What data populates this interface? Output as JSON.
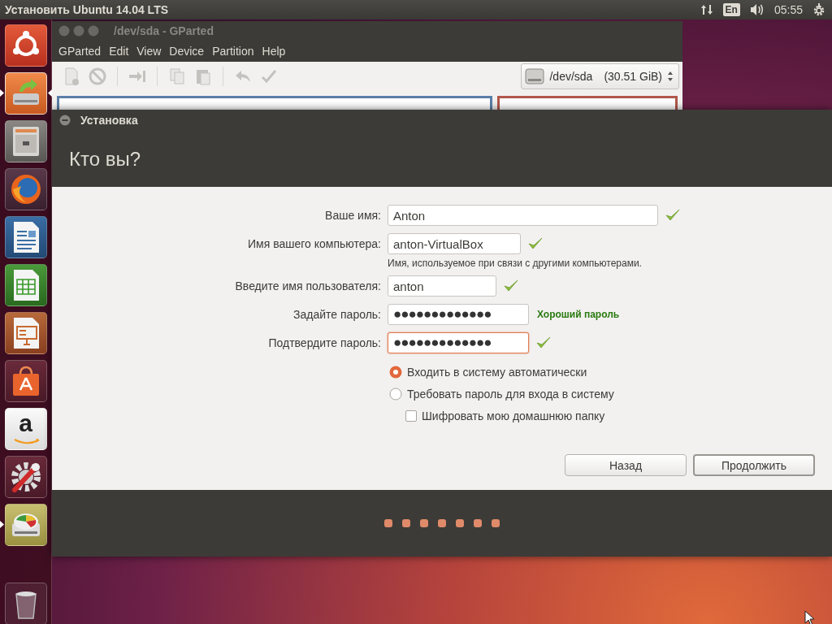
{
  "top_panel": {
    "title": "Установить Ubuntu 14.04 LTS",
    "keyboard_layout": "En",
    "time": "05:55"
  },
  "launcher": {
    "items": [
      {
        "kind": "ubuntu",
        "running": false,
        "focused": false
      },
      {
        "kind": "installer",
        "running": true,
        "focused": true
      },
      {
        "kind": "files",
        "running": false,
        "focused": false
      },
      {
        "kind": "firefox",
        "running": false,
        "focused": false
      },
      {
        "kind": "writer",
        "running": false,
        "focused": false
      },
      {
        "kind": "calc",
        "running": false,
        "focused": false
      },
      {
        "kind": "impress",
        "running": false,
        "focused": false
      },
      {
        "kind": "software",
        "running": false,
        "focused": false
      },
      {
        "kind": "amazon",
        "glyph": "a",
        "running": false,
        "focused": false
      },
      {
        "kind": "settings",
        "running": false,
        "focused": false
      },
      {
        "kind": "gparted",
        "running": true,
        "focused": false
      },
      {
        "kind": "trash",
        "running": false,
        "focused": false
      }
    ]
  },
  "gparted": {
    "title": "/dev/sda - GParted",
    "menu": [
      "GParted",
      "Edit",
      "View",
      "Device",
      "Partition",
      "Help"
    ],
    "device": {
      "name": "/dev/sda",
      "size": "(30.51 GiB)"
    }
  },
  "installer": {
    "title": "Установка",
    "heading": "Кто вы?",
    "fields": [
      {
        "label": "Ваше имя:",
        "value": "Anton",
        "valid": true,
        "focused": false
      },
      {
        "label": "Имя вашего компьютера:",
        "value": "anton-VirtualBox",
        "valid": true,
        "focused": false,
        "hint": "Имя, используемое при связи с другими компьютерами."
      },
      {
        "label": "Введите имя пользователя:",
        "value": "anton",
        "valid": true,
        "focused": false
      },
      {
        "label": "Задайте пароль:",
        "value": "●●●●●●●●●●●●●",
        "valid": false,
        "focused": false,
        "status": "Хороший пароль"
      },
      {
        "label": "Подтвердите пароль:",
        "value": "●●●●●●●●●●●●●",
        "valid": true,
        "focused": true
      }
    ],
    "login_options": [
      {
        "label": "Входить в систему автоматически",
        "selected": true
      },
      {
        "label": "Требовать пароль для входа в систему",
        "selected": false
      }
    ],
    "encrypt": {
      "label": "Шифровать мою домашнюю папку",
      "checked": false
    },
    "buttons": [
      {
        "label": "Назад",
        "default": false
      },
      {
        "label": "Продолжить",
        "default": true
      }
    ]
  }
}
